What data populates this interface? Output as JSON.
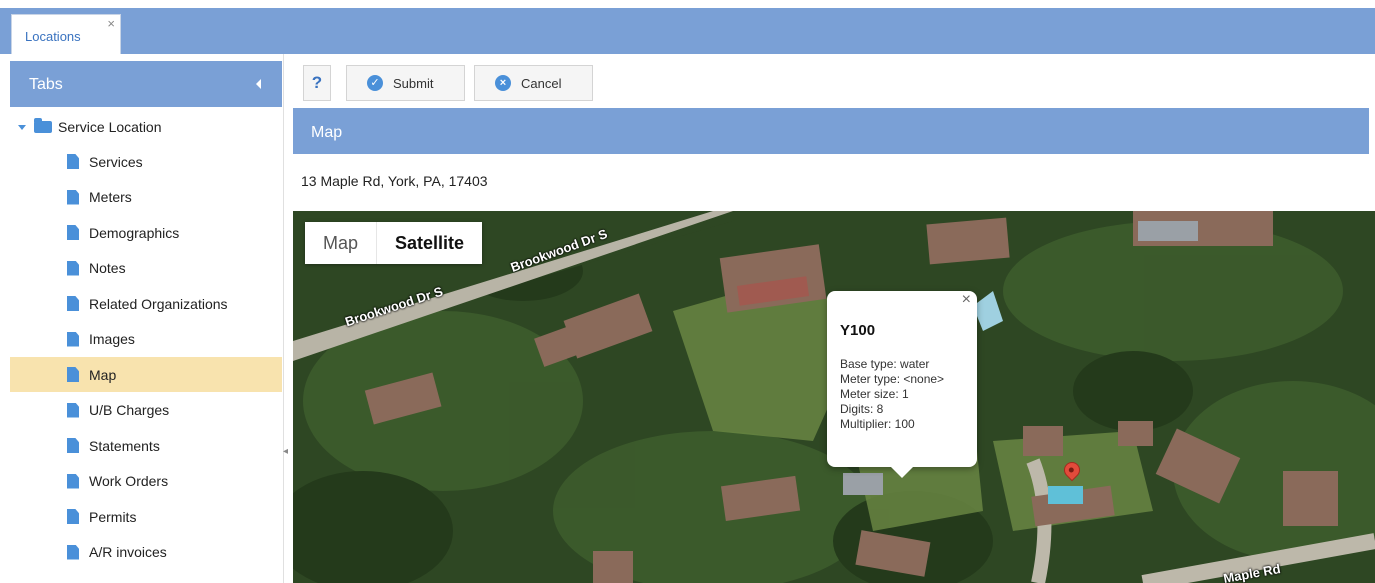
{
  "window_tab": {
    "label": "Locations",
    "close": "×"
  },
  "sidebar": {
    "header": "Tabs",
    "root": "Service Location",
    "items": [
      {
        "label": "Services"
      },
      {
        "label": "Meters"
      },
      {
        "label": "Demographics"
      },
      {
        "label": "Notes"
      },
      {
        "label": "Related Organizations"
      },
      {
        "label": "Images"
      },
      {
        "label": "Map",
        "selected": true
      },
      {
        "label": "U/B Charges"
      },
      {
        "label": "Statements"
      },
      {
        "label": "Work Orders"
      },
      {
        "label": "Permits"
      },
      {
        "label": "A/R invoices"
      }
    ]
  },
  "toolbar": {
    "help": "?",
    "submit": "Submit",
    "cancel": "Cancel"
  },
  "panel": {
    "title": "Map",
    "address": "13 Maple Rd, York, PA, 17403"
  },
  "map": {
    "type_map": "Map",
    "type_satellite": "Satellite",
    "road_labels": [
      "Brookwood Dr S",
      "Brookwood Dr S",
      "Maple Rd"
    ],
    "popup": {
      "title": "Y100",
      "close": "×",
      "lines": [
        "Base type: water",
        "Meter type: <none>",
        "Meter size: 1",
        "Digits: 8",
        "Multiplier: 100"
      ]
    }
  },
  "colors": {
    "header_blue": "#7aa0d6",
    "selected_row": "#f8e3ae",
    "icon_blue": "#4a90d9"
  }
}
